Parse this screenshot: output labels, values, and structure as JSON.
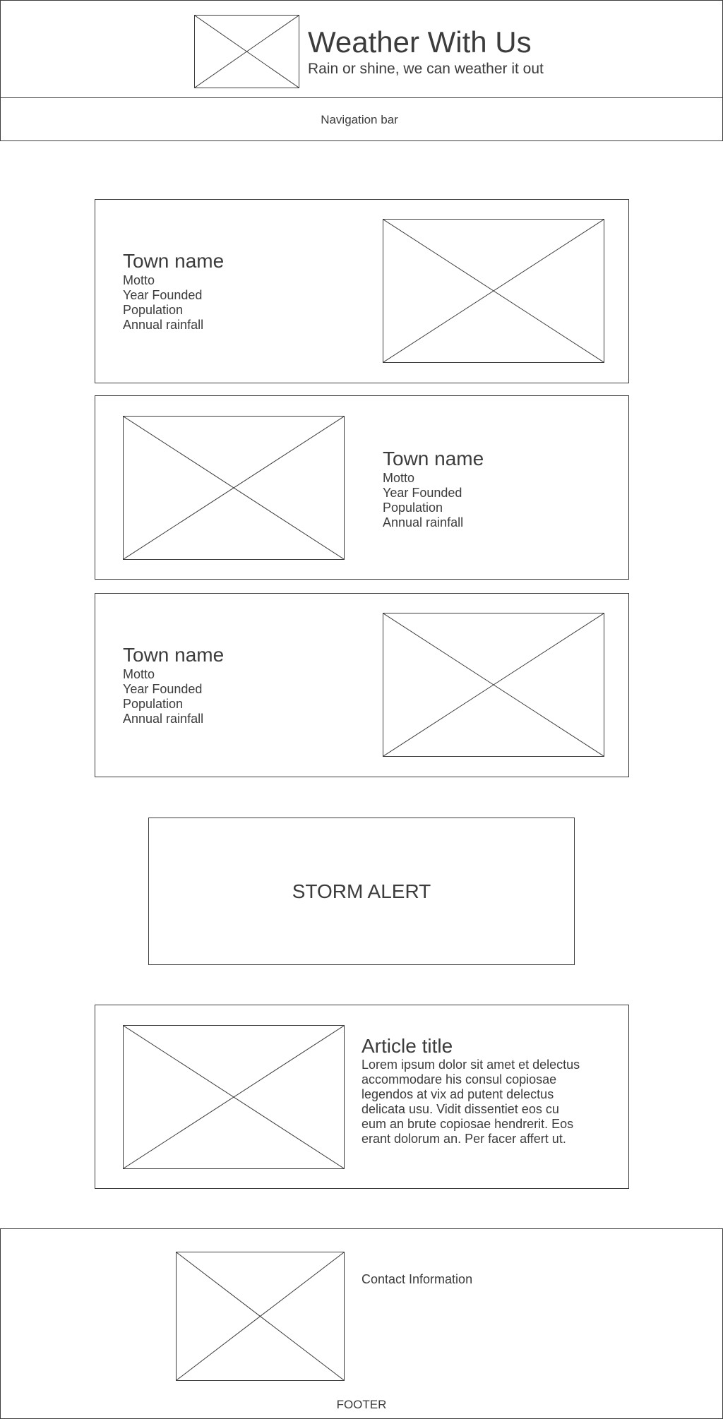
{
  "header": {
    "title": "Weather With Us",
    "subtitle": "Rain or shine, we can weather it out",
    "logo_icon": "image-placeholder-icon"
  },
  "nav": {
    "label": "Navigation bar"
  },
  "towns": [
    {
      "name": "Town name",
      "motto": "Motto",
      "founded": "Year Founded",
      "population": "Population",
      "rainfall": "Annual rainfall",
      "image_icon": "image-placeholder-icon"
    },
    {
      "name": "Town name",
      "motto": "Motto",
      "founded": "Year Founded",
      "population": "Population",
      "rainfall": "Annual rainfall",
      "image_icon": "image-placeholder-icon"
    },
    {
      "name": "Town name",
      "motto": "Motto",
      "founded": "Year Founded",
      "population": "Population",
      "rainfall": "Annual rainfall",
      "image_icon": "image-placeholder-icon"
    }
  ],
  "alert": {
    "label": "STORM ALERT"
  },
  "article": {
    "title": "Article title",
    "body_lines": [
      "Lorem ipsum dolor sit amet et delectus",
      "accommodare his consul copiosae",
      "legendos at vix ad putent delectus",
      "delicata usu. Vidit dissentiet eos cu",
      "eum an brute copiosae hendrerit. Eos",
      "erant dolorum an. Per facer affert ut."
    ],
    "image_icon": "image-placeholder-icon"
  },
  "footer": {
    "contact": "Contact Information",
    "label": "FOOTER",
    "image_icon": "image-placeholder-icon"
  },
  "colors": {
    "line": "#3c3c3c",
    "text": "#3c3c3c",
    "background": "#ffffff"
  }
}
